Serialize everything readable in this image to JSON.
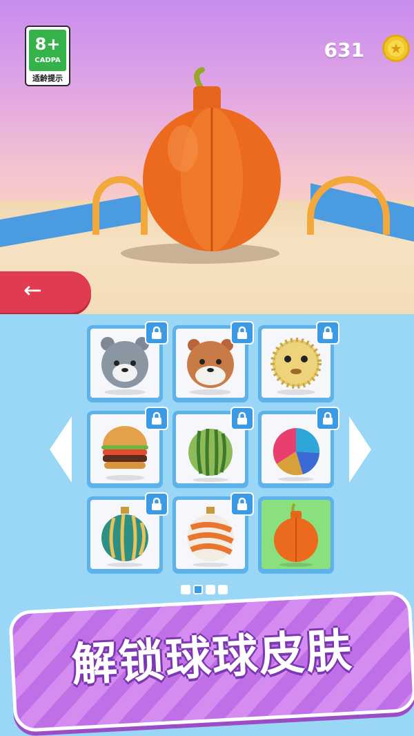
{
  "rating": {
    "age": "8+",
    "org": "CADPA",
    "tip": "适龄提示"
  },
  "coins": {
    "count": "631"
  },
  "back_button": {
    "label": "←"
  },
  "skins": [
    {
      "name": "gray-bear",
      "locked": true
    },
    {
      "name": "brown-bear",
      "locked": true
    },
    {
      "name": "pufferfish",
      "locked": true
    },
    {
      "name": "burger",
      "locked": true
    },
    {
      "name": "watermelon",
      "locked": true
    },
    {
      "name": "beach-ball",
      "locked": true
    },
    {
      "name": "striped-ornament",
      "locked": true
    },
    {
      "name": "candy-ornament",
      "locked": true
    },
    {
      "name": "orange-bomb",
      "locked": false,
      "selected": true
    }
  ],
  "pagination": {
    "pages": 4,
    "current": 2
  },
  "banner": {
    "text": "解锁球球皮肤"
  },
  "colors": {
    "accent": "#3a9ae6",
    "selected": "#89e07c",
    "back": "#e13b52",
    "banner": "#c874e8"
  }
}
